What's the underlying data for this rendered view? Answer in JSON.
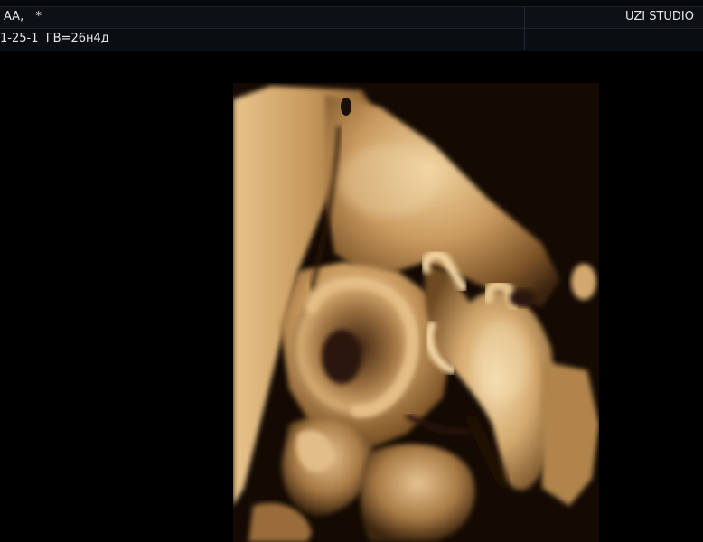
{
  "header": {
    "patient_label": "АА,   *",
    "studio_label": "UZI STUDIO",
    "exam_label": "1-25-1  ГВ=26н4д"
  },
  "image": {
    "subject": "3D ultrasound rendering of fetal face with hand raised",
    "palette": {
      "shadow": "#1a0f05",
      "dark": "#5a3a18",
      "mid": "#a57a45",
      "light": "#d9b07a",
      "highlight": "#f2d8a8"
    }
  }
}
